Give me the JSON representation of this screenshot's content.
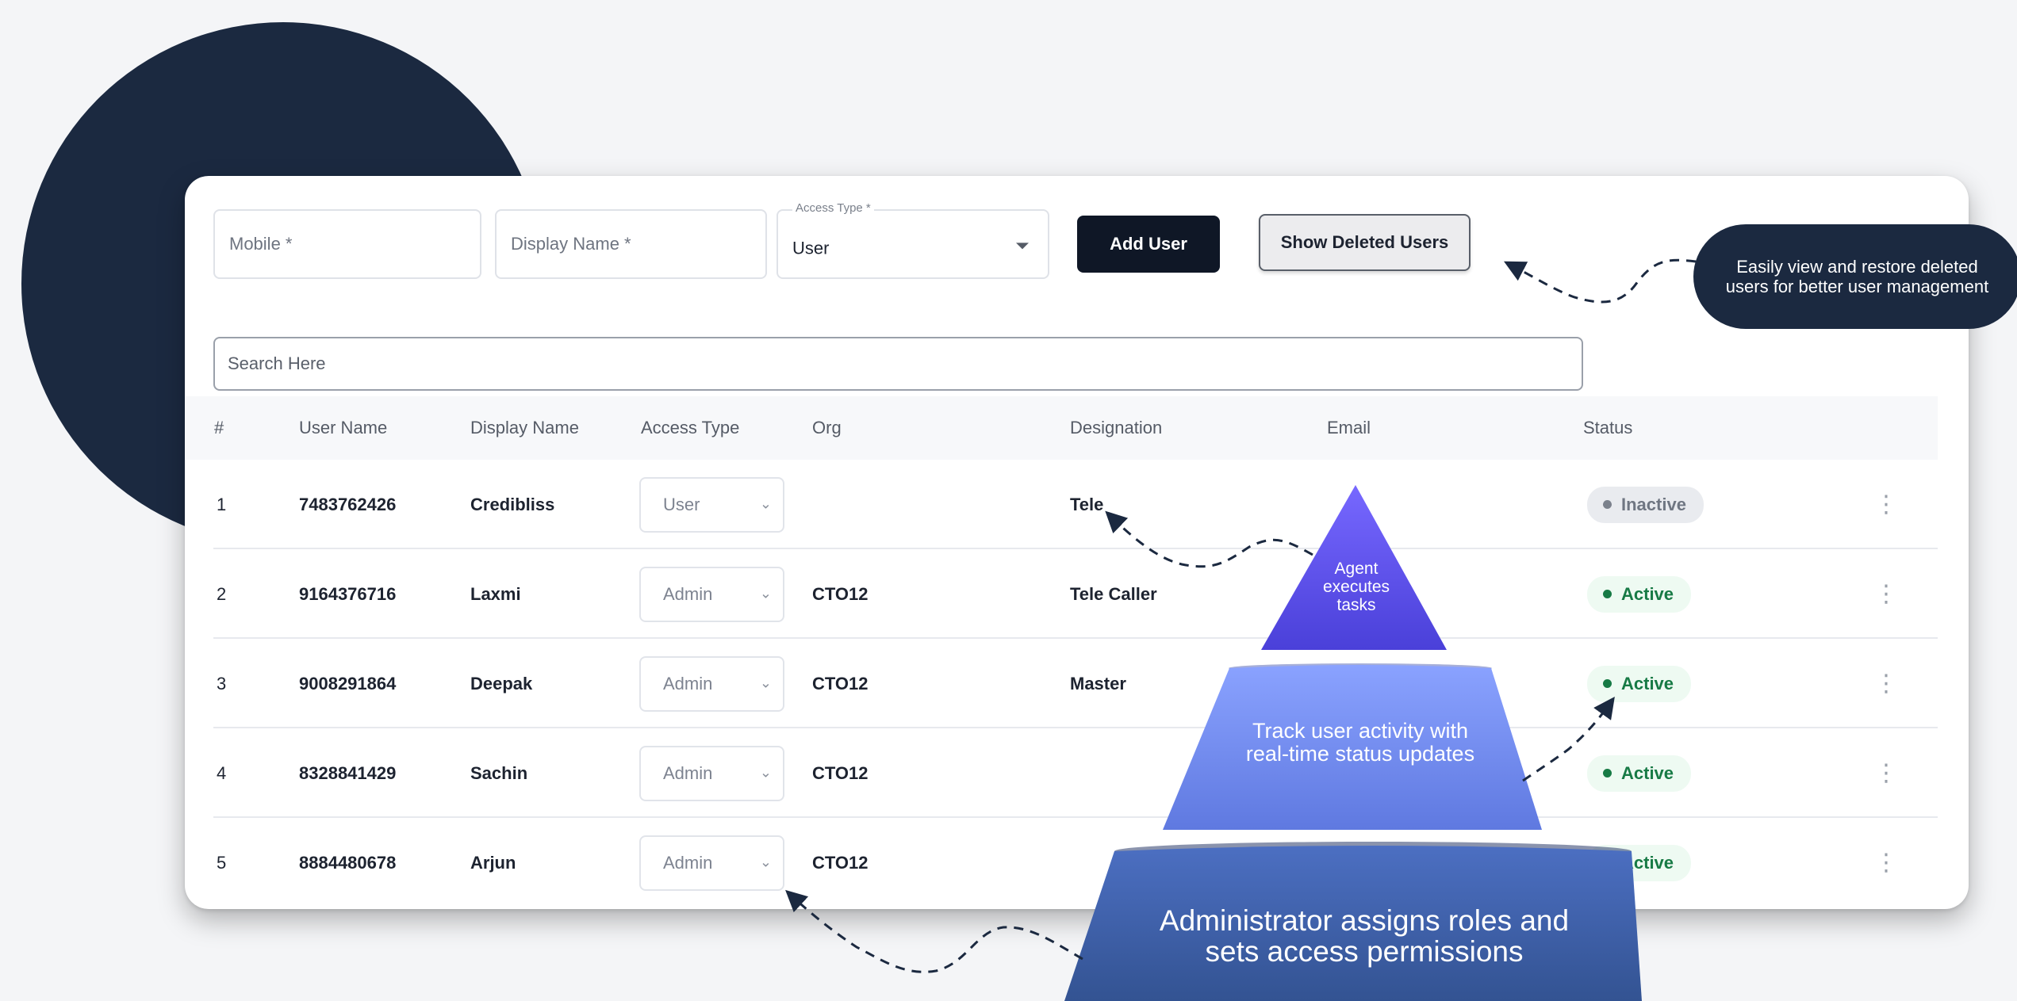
{
  "form": {
    "mobile_placeholder": "Mobile *",
    "display_name_placeholder": "Display Name *",
    "access_type_label": "Access Type *",
    "access_type_value": "User",
    "add_user_label": "Add User",
    "show_deleted_label": "Show Deleted Users"
  },
  "search": {
    "placeholder": "Search Here"
  },
  "table": {
    "headers": [
      "#",
      "User Name",
      "Display Name",
      "Access Type",
      "Org",
      "Designation",
      "Email",
      "Status"
    ],
    "rows": [
      {
        "num": "1",
        "user_name": "7483762426",
        "display_name": "Credibliss",
        "access_type": "User",
        "org": "",
        "designation": "Tele",
        "email": "",
        "status": "Inactive"
      },
      {
        "num": "2",
        "user_name": "9164376716",
        "display_name": "Laxmi",
        "access_type": "Admin",
        "org": "CTO12",
        "designation": "Tele Caller",
        "email": "",
        "status": "Active"
      },
      {
        "num": "3",
        "user_name": "9008291864",
        "display_name": "Deepak",
        "access_type": "Admin",
        "org": "CTO12",
        "designation": "Master",
        "email": "",
        "status": "Active"
      },
      {
        "num": "4",
        "user_name": "8328841429",
        "display_name": "Sachin",
        "access_type": "Admin",
        "org": "CTO12",
        "designation": "",
        "email": "",
        "status": "Active"
      },
      {
        "num": "5",
        "user_name": "8884480678",
        "display_name": "Arjun",
        "access_type": "Admin",
        "org": "CTO12",
        "designation": "",
        "email": "",
        "status": "Active"
      }
    ]
  },
  "annotations": {
    "deleted_users_callout": "Easily view and restore deleted users for better user management",
    "pyramid_top": "Agent executes tasks",
    "pyramid_middle": "Track user activity with real-time status updates",
    "pyramid_bottom": "Administrator assigns roles and sets access permissions"
  },
  "colors": {
    "navy": "#1b2940",
    "button_dark": "#0f1726",
    "active_green": "#177a45",
    "pyramid_top": "#5a4ef0",
    "pyramid_middle": "#6f86f0",
    "pyramid_bottom": "#3f64b0"
  },
  "icons": {
    "select_caret": "chevron-down-icon",
    "row_menu": "kebab-menu-icon",
    "status_dot": "dot-icon"
  }
}
